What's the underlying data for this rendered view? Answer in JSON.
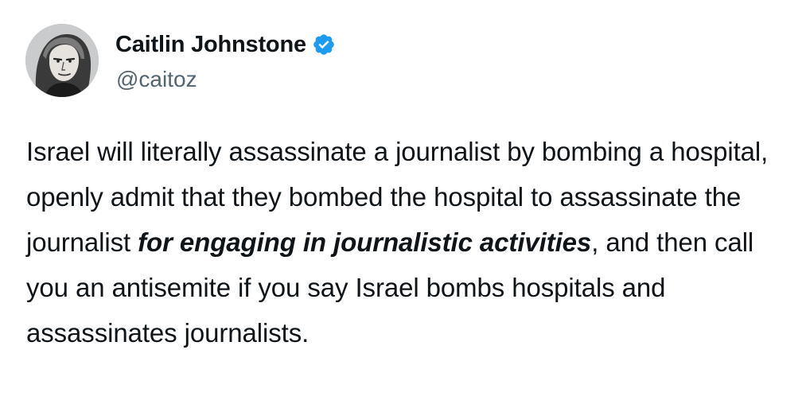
{
  "author": {
    "display_name": "Caitlin Johnstone",
    "handle": "@caitoz",
    "verified": true,
    "verified_color": "#1d9bf0"
  },
  "tweet": {
    "text_part1": "Israel will literally assassinate a journalist by bombing a hospital, openly admit that they bombed the hospital to assassinate the journalist ",
    "text_emphasis": "for engaging in journalistic activities",
    "text_part2": ", and then call you an antisemite if you say Israel bombs hospitals and assassinates journalists."
  },
  "icons": {
    "avatar": "profile-photo",
    "verified": "verified-badge-icon"
  }
}
